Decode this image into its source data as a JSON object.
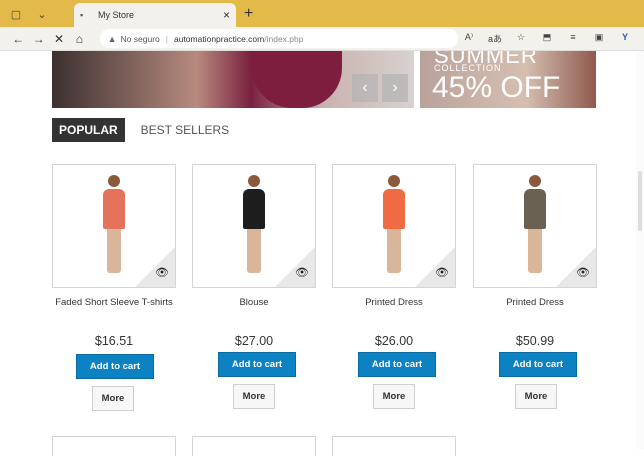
{
  "browser": {
    "tab_title": "My Store",
    "tab_close": "×",
    "new_tab": "+",
    "address": {
      "warning": "No seguro",
      "host": "automationpractice.com",
      "path": "/index.php"
    }
  },
  "banner": {
    "line1": "SUMMER",
    "line2": "COLLECTION",
    "line3": "45% OFF",
    "prev": "‹",
    "next": "›"
  },
  "tabs": {
    "popular": "POPULAR",
    "best_sellers": "BEST SELLERS"
  },
  "products": [
    {
      "name": "Faded Short Sleeve T-shirts",
      "price": "$16.51",
      "add_label": "Add to cart",
      "more_label": "More",
      "dress_color": "#e5725a"
    },
    {
      "name": "Blouse",
      "price": "$27.00",
      "add_label": "Add to cart",
      "more_label": "More",
      "dress_color": "#1d1d1d"
    },
    {
      "name": "Printed Dress",
      "price": "$26.00",
      "add_label": "Add to cart",
      "more_label": "More",
      "dress_color": "#f06a44"
    },
    {
      "name": "Printed Dress",
      "price": "$50.99",
      "add_label": "Add to cart",
      "more_label": "More",
      "dress_color": "#6b6152"
    }
  ],
  "colors": {
    "accent_blue": "#0c82c3",
    "browser_frame": "#e3b94a"
  }
}
